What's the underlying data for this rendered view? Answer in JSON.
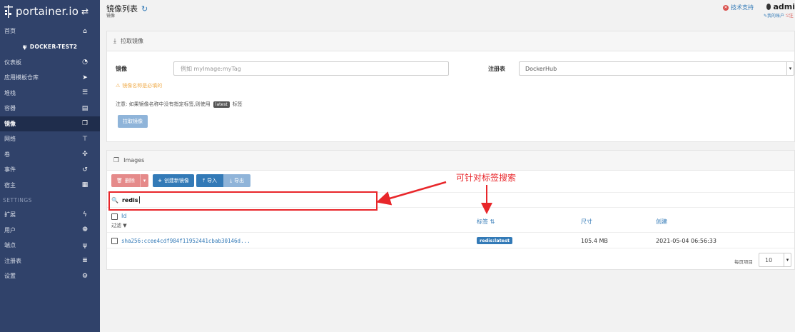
{
  "sidebar": {
    "brand": "portainer.io",
    "endpoint": "DOCKER-TEST2",
    "home": "首页",
    "items": [
      {
        "label": "仪表板",
        "icon": "tachometer-icon",
        "glyph": "◔"
      },
      {
        "label": "应用模板仓库",
        "icon": "rocket-icon",
        "glyph": "➤"
      },
      {
        "label": "堆栈",
        "icon": "list-icon",
        "glyph": "☰"
      },
      {
        "label": "容器",
        "icon": "server-icon",
        "glyph": "▤"
      },
      {
        "label": "镜像",
        "icon": "clone-icon",
        "glyph": "❐"
      },
      {
        "label": "网络",
        "icon": "sitemap-icon",
        "glyph": "⊤"
      },
      {
        "label": "卷",
        "icon": "cubes-icon",
        "glyph": "✣"
      },
      {
        "label": "事件",
        "icon": "history-icon",
        "glyph": "↺"
      },
      {
        "label": "宿主",
        "icon": "th-icon",
        "glyph": "▦"
      }
    ],
    "settings_title": "SETTINGS",
    "settings": [
      {
        "label": "扩展",
        "icon": "bolt-icon",
        "glyph": "ϟ"
      },
      {
        "label": "用户",
        "icon": "users-icon",
        "glyph": "❁"
      },
      {
        "label": "端点",
        "icon": "plug-icon",
        "glyph": "ψ"
      },
      {
        "label": "注册表",
        "icon": "database-icon",
        "glyph": "≣"
      },
      {
        "label": "设置",
        "icon": "cogs-icon",
        "glyph": "⚙"
      }
    ]
  },
  "header": {
    "title": "镜像列表",
    "subtitle": "镜像",
    "support": "技术支持",
    "user": "admi",
    "my_account": "我的账户",
    "logout": "注"
  },
  "pull": {
    "panel_title": "拉取镜像",
    "image_label": "镜像",
    "image_placeholder": "例如 myImage:myTag",
    "registry_label": "注册表",
    "registry_value": "DockerHub",
    "warning": "镜像名称是必填的",
    "note_prefix": "注意: 如果镜像名称中没有指定标签,则使用",
    "note_badge": "latest",
    "note_suffix": "标签",
    "pull_button": "拉取镜像"
  },
  "images": {
    "panel_title": "Images",
    "remove": "删除",
    "build": "创建新镜像",
    "import": "导入",
    "export": "导出",
    "search_value": "redis",
    "columns": {
      "id": "Id",
      "filter": "过滤",
      "tags": "标签",
      "size": "尺寸",
      "created": "创建"
    },
    "rows": [
      {
        "id": "sha256:ccee4cdf984f11952441cbab30146d...",
        "tag": "redis:latest",
        "size": "105.4 MB",
        "created": "2021-05-04 06:56:33"
      }
    ],
    "items_per_page_label": "每页项目",
    "items_per_page": "10"
  },
  "annotation": {
    "text": "可针对标签搜索",
    "color": "#e8262a"
  }
}
